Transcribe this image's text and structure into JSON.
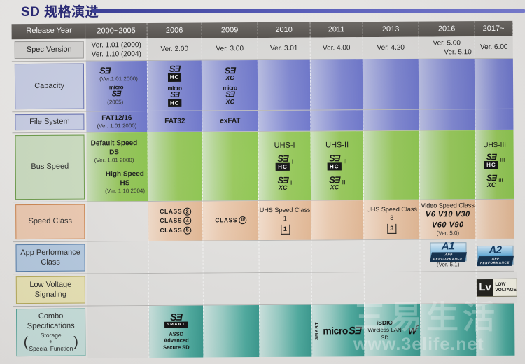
{
  "title": "SD 规格演进",
  "columns": [
    {
      "key": "col0",
      "label": "2000~2005"
    },
    {
      "key": "col1",
      "label": "2006"
    },
    {
      "key": "col2",
      "label": "2009"
    },
    {
      "key": "col3",
      "label": "2010"
    },
    {
      "key": "col4",
      "label": "2011"
    },
    {
      "key": "col5",
      "label": "2013"
    },
    {
      "key": "col6",
      "label": "2016"
    },
    {
      "key": "col7",
      "label": "2017~"
    }
  ],
  "rows": {
    "release_year": {
      "label": "Release Year"
    },
    "spec_version": {
      "label": "Spec Version",
      "cells": [
        {
          "line1": "Ver. 1.01 (2000)",
          "line2": "Ver. 1.10 (2004)"
        },
        {
          "line1": "Ver. 2.00",
          "line2": ""
        },
        {
          "line1": "Ver. 3.00",
          "line2": ""
        },
        {
          "line1": "Ver. 3.01",
          "line2": ""
        },
        {
          "line1": "Ver. 4.00",
          "line2": ""
        },
        {
          "line1": "Ver. 4.20",
          "line2": ""
        },
        {
          "line1": "Ver. 5.00",
          "line2": "Ver. 5.10"
        },
        {
          "line1": "Ver. 6.00",
          "line2": ""
        }
      ]
    },
    "capacity": {
      "label": "Capacity",
      "col0": {
        "logo1": "SD",
        "note1": "(Ver.1.01 2000)",
        "logo2": "microSD",
        "note2": "(2005)"
      },
      "col1": {
        "logo1": "SDHC",
        "logo2": "microSDHC"
      },
      "col2": {
        "logo1": "SDXC",
        "logo2": "microSDXC"
      }
    },
    "file_system": {
      "label": "File System",
      "col0": {
        "value": "FAT12/16",
        "note": "(Ver. 1.01 2000)"
      },
      "col1": {
        "value": "FAT32",
        "note": ""
      },
      "col2": {
        "value": "exFAT",
        "note": ""
      }
    },
    "bus_speed": {
      "label": "Bus Speed",
      "col0": {
        "a_name": "Default Speed",
        "a_abbr": "DS",
        "a_note": "(Ver. 1.01 2000)",
        "b_name": "High Speed",
        "b_abbr": "HS",
        "b_note": "(Ver. 1.10 2004)"
      },
      "col3": {
        "title": "UHS-I",
        "mark1": "SDHC",
        "suffix1": "I",
        "mark2": "SDXC",
        "suffix2": "I"
      },
      "col4": {
        "title": "UHS-II",
        "mark1": "SDHC",
        "suffix1": "II",
        "mark2": "SDXC",
        "suffix2": "II"
      },
      "col7": {
        "title": "UHS-III",
        "mark1": "SDHC",
        "suffix1": "III",
        "mark2": "SDXC",
        "suffix2": "III"
      }
    },
    "speed_class": {
      "label": "Speed Class",
      "col1": {
        "classes": [
          {
            "word": "CLASS",
            "num": "2"
          },
          {
            "word": "CLASS",
            "num": "4"
          },
          {
            "word": "CLASS",
            "num": "6"
          }
        ]
      },
      "col2": {
        "classes": [
          {
            "word": "CLASS",
            "num": "10"
          }
        ]
      },
      "col3": {
        "title": "UHS Speed Class 1",
        "badge": "1"
      },
      "col5": {
        "title": "UHS Speed Class 3",
        "badge": "3"
      },
      "col6": {
        "title": "Video Speed Class",
        "line1": "V6 V10 V30",
        "line2": "V60 V90",
        "note": "(Ver. 5.0)"
      }
    },
    "app_performance": {
      "label": "App Performance Class",
      "label_line1": "App Performance",
      "label_line2": "Class",
      "col6": {
        "badge": "A1",
        "badge_sub": "APP PERFORMANCE",
        "note": "(Ver. 5.1)"
      },
      "col7": {
        "badge": "A2",
        "badge_sub": "APP PERFORMANCE"
      }
    },
    "low_voltage": {
      "label": "Low Voltage Signaling",
      "label_line1": "Low Voltage",
      "label_line2": "Signaling",
      "col7": {
        "badge": "Lv",
        "text1": "LOW",
        "text2": "VOLTAGE"
      }
    },
    "combo": {
      "label": "Combo Specifications",
      "label_line1": "Combo",
      "label_line2": "Specifications",
      "paren_line1": "Storage",
      "paren_plus": "+",
      "paren_line2": "Special Function",
      "col1": {
        "logo": "SD SMART",
        "name1": "ASSD",
        "name2": "Advanced",
        "name3": "Secure SD"
      },
      "col4": {
        "logo": "microSD",
        "vertical": "SMART"
      },
      "col5": {
        "logo": "iSDIO",
        "name": "Wireless LAN SD"
      }
    }
  },
  "watermark": {
    "chinese": "三易生活",
    "url": "www.3elife.net"
  },
  "colors": {
    "title": "#2b2b7a",
    "header_bar": "#56524e",
    "capacity": "#7f87d2",
    "bus_speed": "#97c85a",
    "speed_class": "#e3b894",
    "app_performance": "#b8cde4",
    "low_voltage": "#ece6b8",
    "combo": "#4fada1"
  }
}
